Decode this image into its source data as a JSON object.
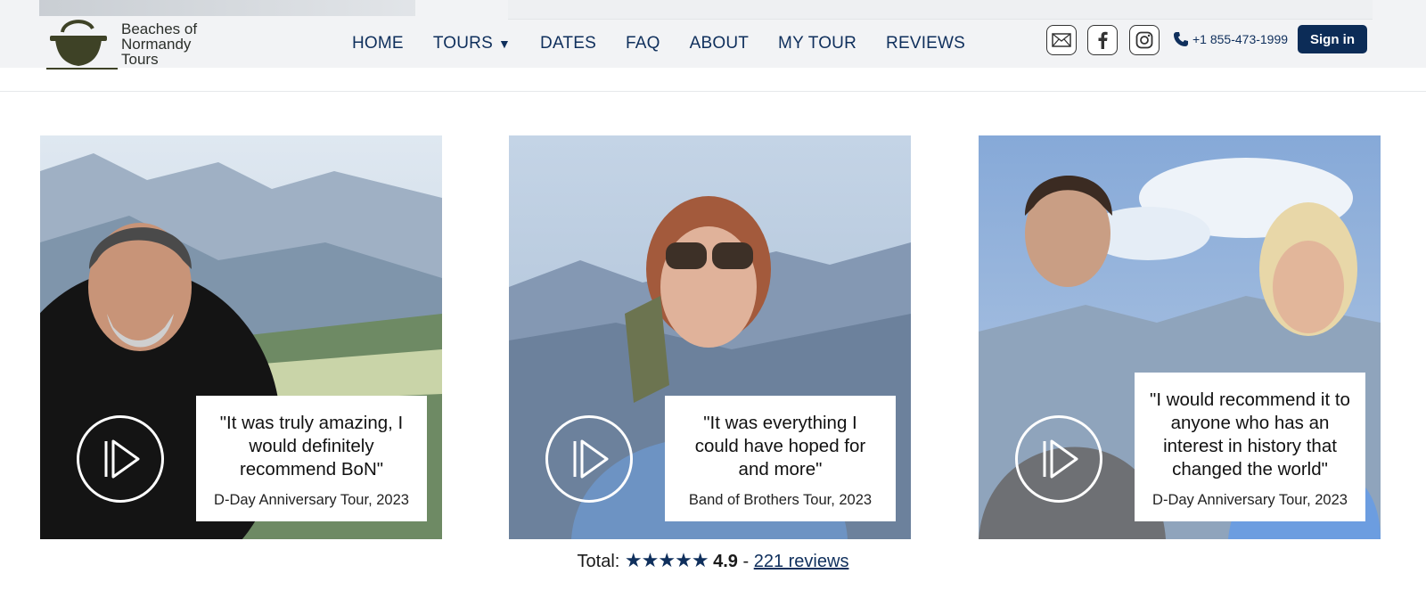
{
  "brand": {
    "line1": "Beaches of",
    "line2": "Normandy",
    "line3": "Tours"
  },
  "nav": {
    "home": "HOME",
    "tours": "TOURS",
    "dates": "DATES",
    "faq": "FAQ",
    "about": "ABOUT",
    "mytour": "MY TOUR",
    "reviews": "REVIEWS"
  },
  "icons": {
    "email": "mail-icon",
    "facebook": "facebook-icon",
    "instagram": "instagram-icon",
    "phone": "phone-icon",
    "caret": "caret-down-icon",
    "play": "play-icon"
  },
  "contact": {
    "phone": "+1 855-473-1999"
  },
  "account": {
    "signin": "Sign in"
  },
  "testimonials": [
    {
      "quote": "\"It was truly amazing, I would definitely recommend BoN\"",
      "caption": "D-Day Anniversary Tour, 2023"
    },
    {
      "quote": "\"It was everything I could have hoped for and more\"",
      "caption": "Band of Brothers Tour, 2023"
    },
    {
      "quote": "\"I would recommend it to anyone who has an interest in history that changed the world\"",
      "caption": "D-Day Anniversary Tour, 2023"
    }
  ],
  "summary": {
    "label": "Total:",
    "stars": "★★★★★",
    "rating": "4.9",
    "separator": "-",
    "reviews_link": "221 reviews"
  },
  "colors": {
    "navy": "#0f2f5c",
    "signin_bg": "#0c2c57",
    "header_bg": "#f2f3f5"
  }
}
